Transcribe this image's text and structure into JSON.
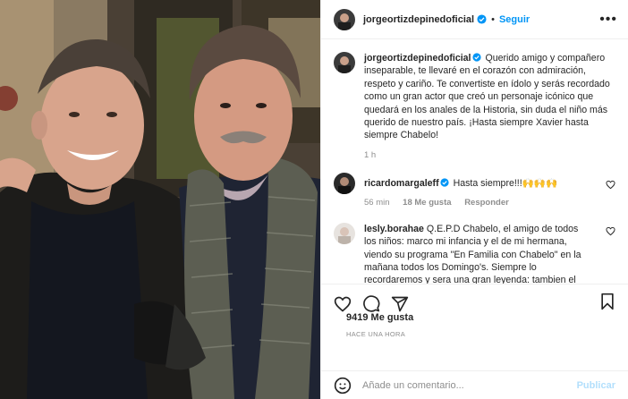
{
  "post": {
    "username": "jorgeortizdepinedoficial",
    "follow_label": "Seguir",
    "caption": "Querido amigo y compañero inseparable, te llevaré en el corazón con admiración, respeto y cariño. Te convertiste en ídolo y serás recordado como un gran actor que creó un personaje icónico que quedará en los anales de la Historia, sin duda el niño más querido de nuestro país. ¡Hasta siempre Xavier hasta siempre Chabelo!",
    "caption_time": "1 h",
    "likes": "9419 Me gusta",
    "posted": "HACE UNA HORA"
  },
  "comments": [
    {
      "username": "ricardomargaleff",
      "text": "Hasta siempre!!!🙌🙌🙌",
      "time": "56 min",
      "likes": "18 Me gusta",
      "reply": "Responder"
    },
    {
      "username": "lesly.borahae",
      "text": "Q.E.P.D Chabelo, el amigo de todos los niños: marco mi infancia y el de mi hermana, viendo su programa \"En Familia con Chabelo\" en la mañana todos los Domingo's. Siempre lo recordaremos y sera una gran leyenda: tambien el"
    }
  ],
  "add_comment": {
    "placeholder": "Añade un comentario...",
    "publish_label": "Publicar"
  },
  "colors": {
    "accent": "#0095f6",
    "publish_disabled": "#b2dffc",
    "muted": "#8e8e8e"
  }
}
